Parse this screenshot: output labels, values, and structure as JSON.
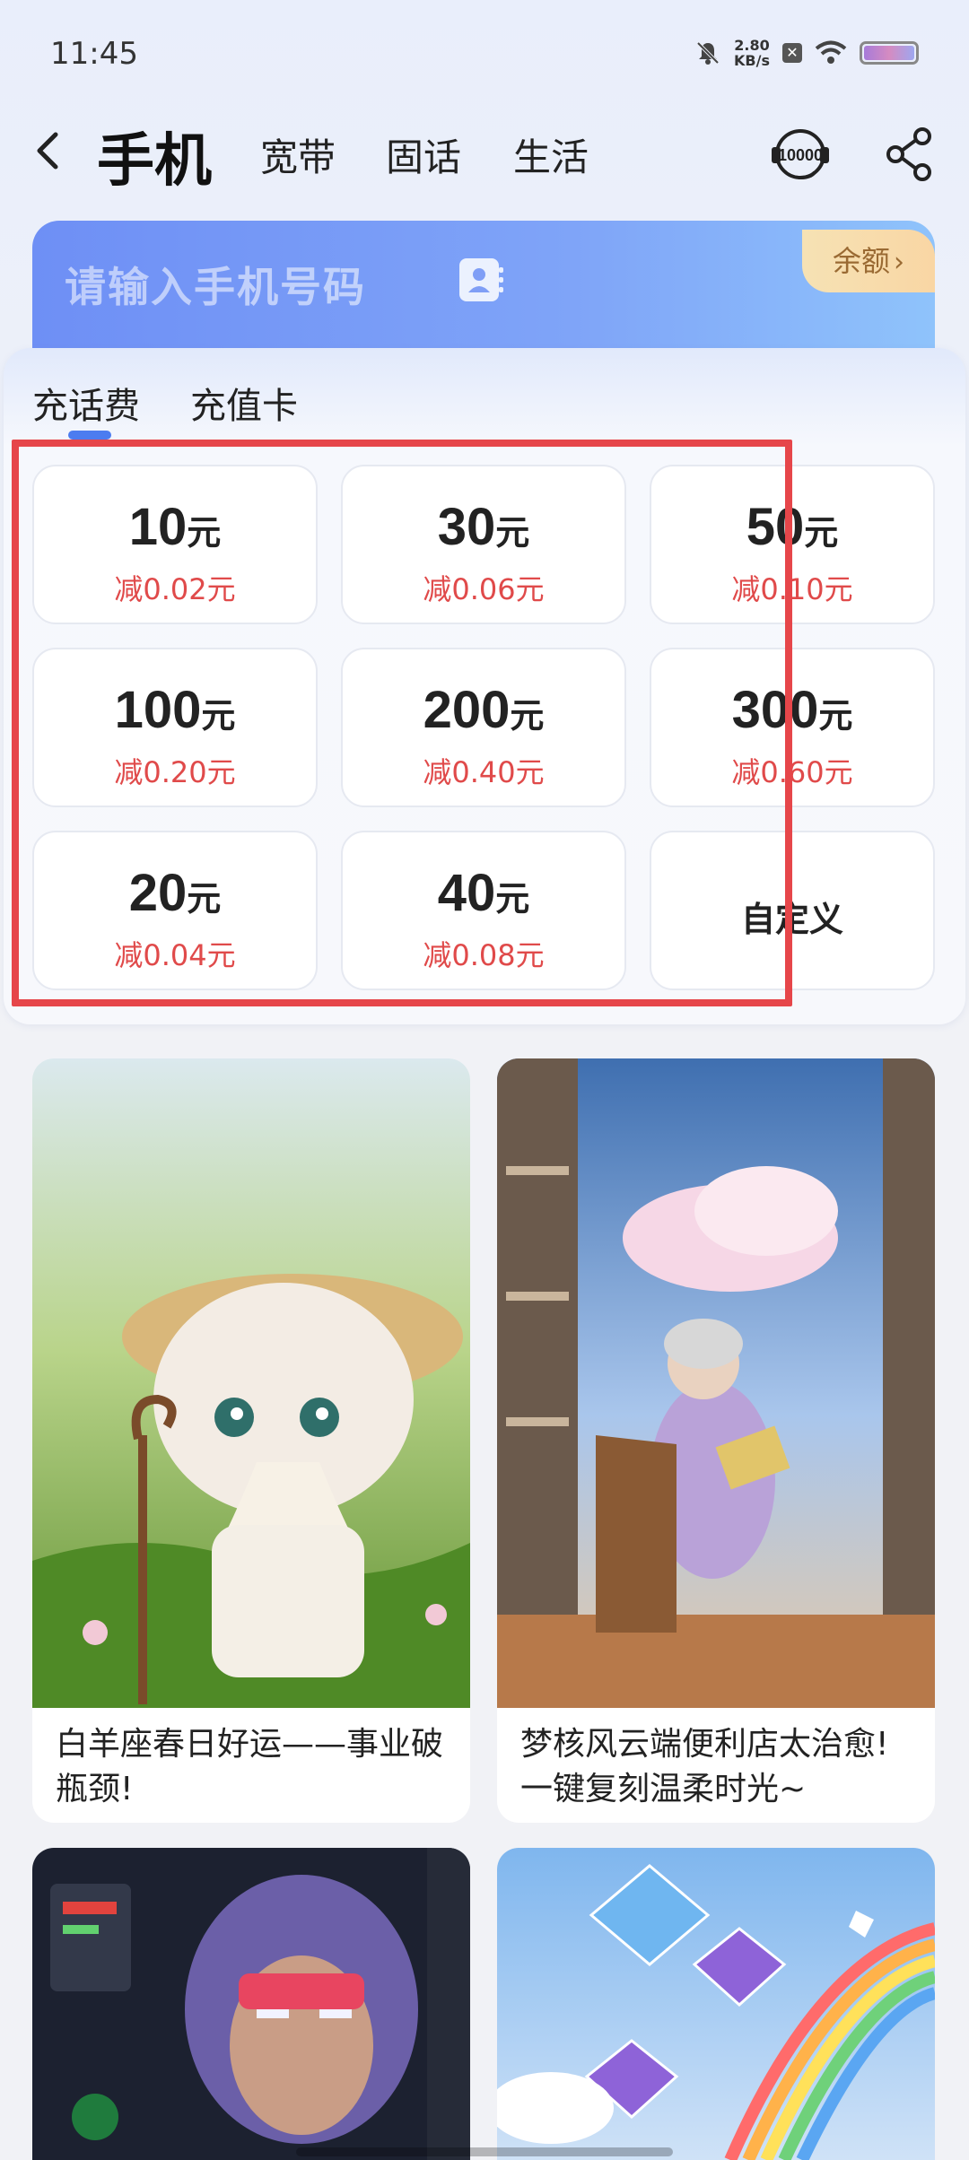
{
  "status_bar": {
    "time": "11:45",
    "speed_value": "2.80",
    "speed_unit": "KB/s"
  },
  "header": {
    "tabs": [
      {
        "label": "手机",
        "active": true
      },
      {
        "label": "宽带"
      },
      {
        "label": "固话"
      },
      {
        "label": "生活"
      }
    ],
    "service_icon_label": "10000"
  },
  "phone_input": {
    "placeholder": "请输入手机号码",
    "balance_label": "余额",
    "balance_chevron": "›"
  },
  "recharge": {
    "tabs": [
      {
        "label": "充话费",
        "active": true
      },
      {
        "label": "充值卡"
      }
    ],
    "unit": "元",
    "amounts": [
      {
        "value": "10",
        "discount": "减0.02元"
      },
      {
        "value": "30",
        "discount": "减0.06元"
      },
      {
        "value": "50",
        "discount": "减0.10元"
      },
      {
        "value": "100",
        "discount": "减0.20元"
      },
      {
        "value": "200",
        "discount": "减0.40元"
      },
      {
        "value": "300",
        "discount": "减0.60元"
      },
      {
        "value": "20",
        "discount": "减0.04元"
      },
      {
        "value": "40",
        "discount": "减0.08元"
      }
    ],
    "custom_label": "自定义"
  },
  "feed": [
    {
      "title": "白羊座春日好运——事业破瓶颈!"
    },
    {
      "title": "梦核风云端便利店太治愈!一键复刻温柔时光~"
    },
    {
      "title": ""
    },
    {
      "title": ""
    }
  ],
  "colors": {
    "accent": "#4c7cf0",
    "discount": "#e04a4a",
    "highlight": "#e6464a",
    "balance_tag": "#f6e2b4"
  }
}
